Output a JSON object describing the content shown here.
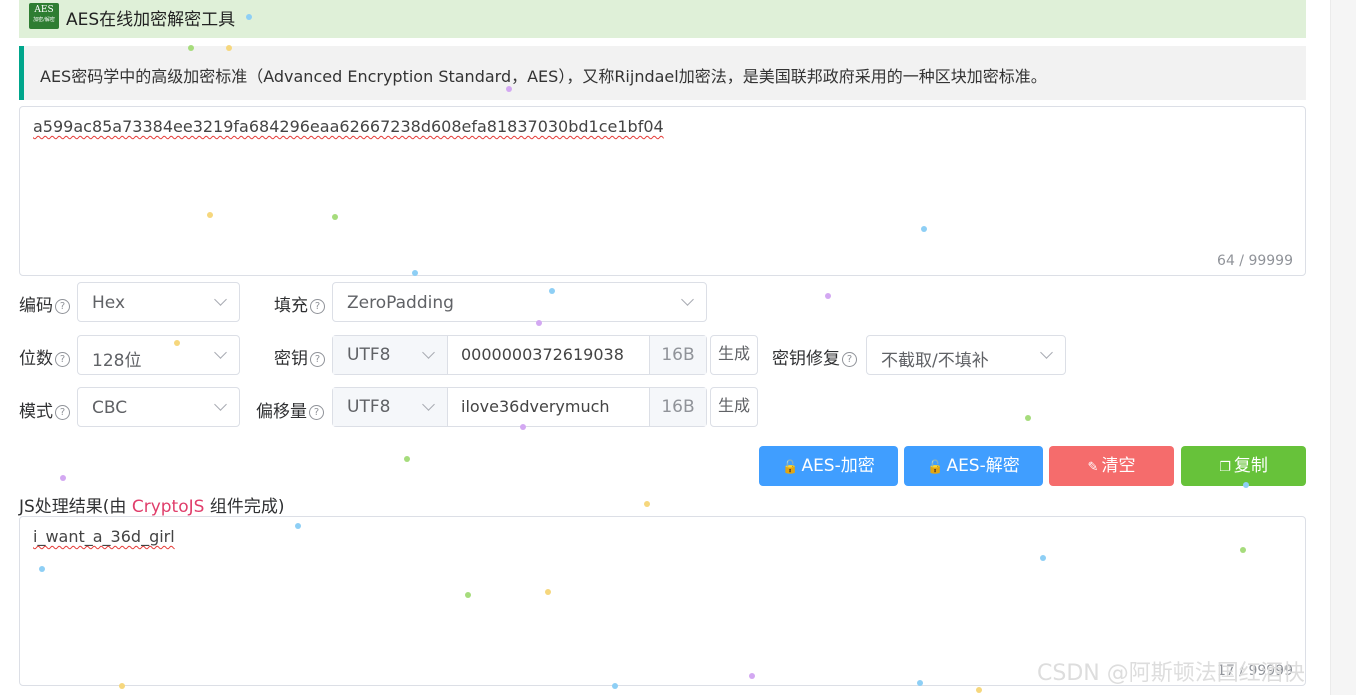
{
  "app": {
    "title": "AES在线加密解密工具",
    "logo_line1": "AES",
    "logo_line2": "加密/解密"
  },
  "description": "AES密码学中的高级加密标准（Advanced Encryption Standard，AES），又称Rijndael加密法，是美国联邦政府采用的一种区块加密标准。",
  "input": {
    "value": "a599ac85a73384ee3219fa684296eaa62667238d608efa81837030bd1ce1bf04",
    "counter": "64 / 99999"
  },
  "options": {
    "encoding": {
      "label": "编码",
      "value": "Hex"
    },
    "padding": {
      "label": "填充",
      "value": "ZeroPadding"
    },
    "bits": {
      "label": "位数",
      "value": "128位"
    },
    "mode": {
      "label": "模式",
      "value": "CBC"
    },
    "key": {
      "label": "密钥",
      "charset": "UTF8",
      "value": "0000000372619038",
      "size": "16B",
      "generate": "生成"
    },
    "iv": {
      "label": "偏移量",
      "charset": "UTF8",
      "value": "ilove36dverymuch",
      "size": "16B",
      "generate": "生成"
    },
    "key_fix": {
      "label": "密钥修复",
      "value": "不截取/不填补"
    },
    "help_glyph": "?"
  },
  "buttons": {
    "encrypt": "AES-加密",
    "decrypt": "AES-解密",
    "clear": "清空",
    "copy": "复制"
  },
  "result": {
    "label_prefix": "JS处理结果(由 ",
    "label_lib": "CryptoJS",
    "label_suffix": " 组件完成)",
    "value": "i_want_a_36d_girl",
    "counter": "17 / 99999"
  },
  "watermark": "CSDN @阿斯顿法国红酒快",
  "colors": {
    "primary": "#409eff",
    "danger": "#f56c6c",
    "success": "#67c23a",
    "accent": "#00a68c",
    "title_bg": "#dff0d8"
  },
  "icons": {
    "encrypt": "lock-icon",
    "decrypt": "lock-icon",
    "clear": "brush-icon",
    "copy": "copy-icon",
    "help": "question-circle-icon",
    "dropdown": "chevron-down-icon"
  }
}
